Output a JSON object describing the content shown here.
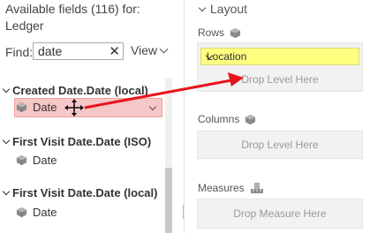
{
  "fields_panel": {
    "header": "Available fields (116) for: Ledger",
    "find_label": "Find:",
    "find_value": "date",
    "clear_glyph": "✕",
    "view_label": "View",
    "groups": [
      {
        "label": "Created Date.Date (local)",
        "field": "Date",
        "selected": true
      },
      {
        "label": "First Visit Date.Date (ISO)",
        "field": "Date",
        "selected": false
      },
      {
        "label": "First Visit Date.Date (local)",
        "field": "Date",
        "selected": false
      }
    ]
  },
  "layout_panel": {
    "title": "Layout",
    "rows": {
      "label": "Rows",
      "chip": "Location",
      "drop_text": "Drop Level Here"
    },
    "columns": {
      "label": "Columns",
      "drop_text": "Drop Level Here"
    },
    "measures": {
      "label": "Measures",
      "drop_text": "Drop Measure Here"
    }
  },
  "colors": {
    "selected_bg": "#f6c7c7",
    "chip_bg": "#ffff7f",
    "arrow": "#e8141d"
  },
  "icons": {
    "dimension": "cube-icon",
    "move": "move-cursor-icon",
    "measure": "ruler-icon"
  }
}
